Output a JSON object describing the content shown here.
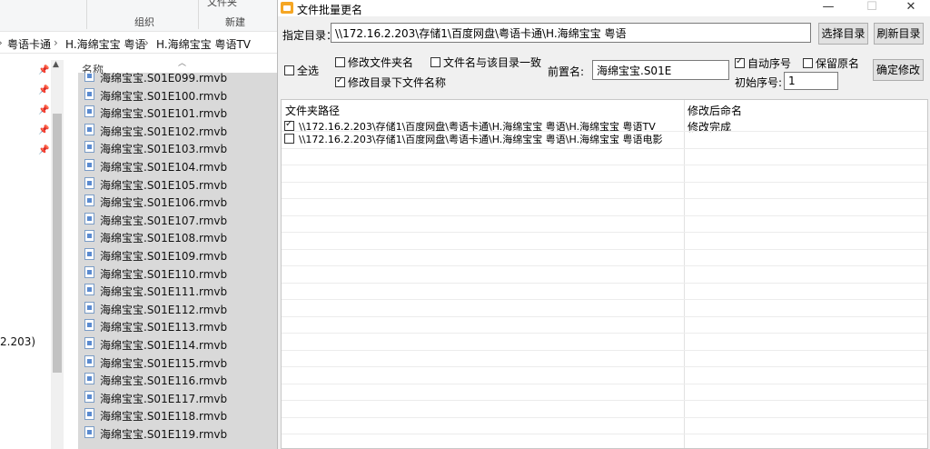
{
  "explorer": {
    "ribbon": {
      "top_label": "文件夹",
      "group_label": "组织",
      "new_label": "新建"
    },
    "breadcrumb": [
      "粤语卡通",
      "H.海绵宝宝 粤语",
      "H.海绵宝宝 粤语TV"
    ],
    "column_header": "名称",
    "left_partial_text": "2.203)",
    "files": [
      "海绵宝宝.S01E099.rmvb",
      "海绵宝宝.S01E100.rmvb",
      "海绵宝宝.S01E101.rmvb",
      "海绵宝宝.S01E102.rmvb",
      "海绵宝宝.S01E103.rmvb",
      "海绵宝宝.S01E104.rmvb",
      "海绵宝宝.S01E105.rmvb",
      "海绵宝宝.S01E106.rmvb",
      "海绵宝宝.S01E107.rmvb",
      "海绵宝宝.S01E108.rmvb",
      "海绵宝宝.S01E109.rmvb",
      "海绵宝宝.S01E110.rmvb",
      "海绵宝宝.S01E111.rmvb",
      "海绵宝宝.S01E112.rmvb",
      "海绵宝宝.S01E113.rmvb",
      "海绵宝宝.S01E114.rmvb",
      "海绵宝宝.S01E115.rmvb",
      "海绵宝宝.S01E116.rmvb",
      "海绵宝宝.S01E117.rmvb",
      "海绵宝宝.S01E118.rmvb",
      "海绵宝宝.S01E119.rmvb"
    ]
  },
  "dialog": {
    "title": "文件批量更名",
    "minimize_glyph": "—",
    "maximize_glyph": "☐",
    "close_glyph": "✕",
    "dir_label": "指定目录：",
    "dir_value": "\\\\172.16.2.203\\存储1\\百度网盘\\粤语卡通\\H.海绵宝宝 粤语",
    "choose_dir_button": "选择目录",
    "refresh_dir_button": "刷新目录",
    "select_all": {
      "label": "全选",
      "checked": false
    },
    "modify_folder_name": {
      "label": "修改文件夹名",
      "checked": false
    },
    "filename_match_dir": {
      "label": "文件名与该目录一致",
      "checked": false
    },
    "modify_files_in_dir": {
      "label": "修改目录下文件名称",
      "checked": true
    },
    "prefix_label": "前置名:",
    "prefix_value": "海绵宝宝.S01E",
    "auto_seq": {
      "label": "自动序号",
      "checked": true
    },
    "keep_original": {
      "label": "保留原名",
      "checked": false
    },
    "start_seq_label": "初始序号:",
    "start_seq_value": "1",
    "confirm_button": "确定修改",
    "grid": {
      "col_path": "文件夹路径",
      "col_new_name": "修改后命名",
      "rows": [
        {
          "checked": true,
          "path": "\\\\172.16.2.203\\存储1\\百度网盘\\粤语卡通\\H.海绵宝宝 粤语\\H.海绵宝宝 粤语TV",
          "new_name": "修改完成"
        },
        {
          "checked": false,
          "path": "\\\\172.16.2.203\\存储1\\百度网盘\\粤语卡通\\H.海绵宝宝 粤语\\H.海绵宝宝 粤语电影",
          "new_name": ""
        }
      ]
    }
  },
  "icons": {
    "pin": "pin-icon",
    "file": "file-icon",
    "app": "app-icon",
    "sort": "sort-up-icon"
  },
  "colors": {
    "dialog_bg": "#f0f0f0",
    "selection_bg": "#d9d9d9",
    "app_icon": "#f5a623"
  }
}
